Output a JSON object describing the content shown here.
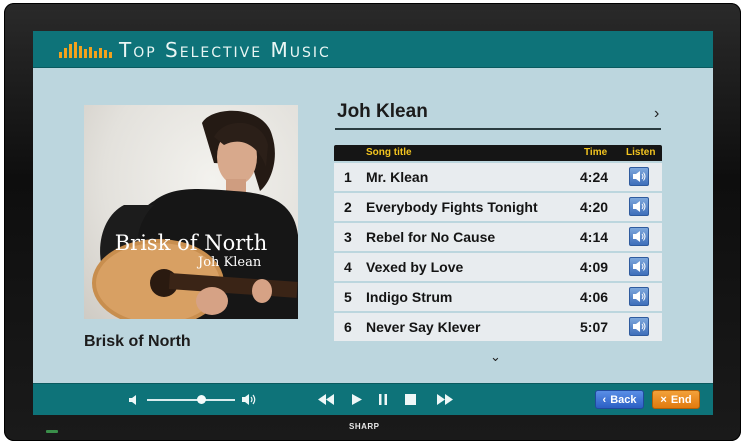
{
  "app": {
    "title": "Top Selective Music"
  },
  "tv": {
    "brand": "SHARP"
  },
  "album": {
    "cover_title": "Brisk of North",
    "cover_artist": "Joh Klean",
    "caption": "Brisk of North"
  },
  "artist": {
    "name": "Joh Klean"
  },
  "tracklist": {
    "headers": {
      "song_title": "Song title",
      "time": "Time",
      "listen": "Listen"
    },
    "tracks": [
      {
        "num": "1",
        "title": "Mr. Klean",
        "time": "4:24"
      },
      {
        "num": "2",
        "title": "Everybody Fights Tonight",
        "time": "4:20"
      },
      {
        "num": "3",
        "title": "Rebel for No Cause",
        "time": "4:14"
      },
      {
        "num": "4",
        "title": "Vexed by Love",
        "time": "4:09"
      },
      {
        "num": "5",
        "title": "Indigo Strum",
        "time": "4:06"
      },
      {
        "num": "6",
        "title": "Never Say Klever",
        "time": "5:07"
      }
    ]
  },
  "player": {
    "volume_fraction": 0.62
  },
  "nav": {
    "back_label": "Back",
    "end_label": "End"
  },
  "colors": {
    "bar": "#0e7379",
    "screen_bg": "#bcd6de",
    "header_accent": "#f2c420",
    "back": "#2b5fc4",
    "end": "#e07a0e"
  },
  "icons": {
    "logo": "equalizer-bars-icon",
    "speaker": "speaker-icon",
    "prev": "rewind-icon",
    "play": "play-icon",
    "pause": "pause-icon",
    "stop": "stop-icon",
    "next": "fast-forward-icon"
  }
}
